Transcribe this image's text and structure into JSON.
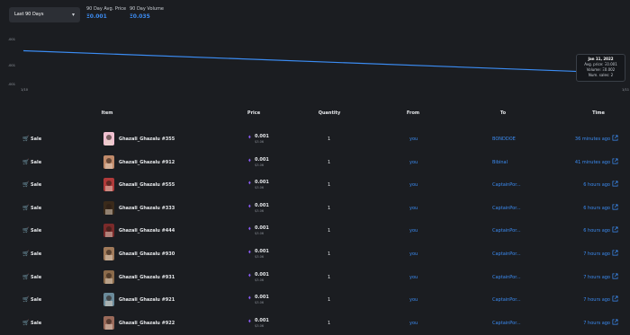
{
  "period": {
    "selected": "Last 90 Days"
  },
  "stats": {
    "avg_label": "90 Day Avg. Price",
    "avg_value": "Ξ0.001",
    "vol_label": "90 Day Volume",
    "vol_value": "Ξ0.035"
  },
  "chart_data": {
    "type": "line",
    "y_ticks": [
      ".001",
      ".001",
      ".001"
    ],
    "x_ticks": [
      "1/10",
      "1/11"
    ],
    "series": [
      {
        "points": [
          [
            0,
            0.0011
          ],
          [
            1,
            0.001
          ]
        ]
      }
    ],
    "line_color": "#3b8cf3",
    "tooltip": {
      "date": "Jan 11, 2022",
      "avg": "Avg. price: Ξ0.001",
      "volume": "Volume: Ξ0.002",
      "sales": "Num. sales: 2"
    }
  },
  "table": {
    "headers": [
      "Item",
      "Price",
      "Quantity",
      "From",
      "To",
      "Time"
    ],
    "rows": [
      {
        "event": "Sale",
        "item": "Ghazali_Ghazalu #355",
        "price": "0.001",
        "usd": "$3.06",
        "qty": "1",
        "from": "you",
        "to": "BONDDOE",
        "time": "36 minutes ago",
        "thumb": "#f0c0d0"
      },
      {
        "event": "Sale",
        "item": "Ghazali_Ghazalu #912",
        "price": "0.001",
        "usd": "$3.06",
        "qty": "1",
        "from": "you",
        "to": "Bibinal",
        "time": "41 minutes ago",
        "thumb": "#c08a6a"
      },
      {
        "event": "Sale",
        "item": "Ghazali_Ghazalu #555",
        "price": "0.001",
        "usd": "$3.06",
        "qty": "1",
        "from": "you",
        "to": "CaptainPor...",
        "time": "6 hours ago",
        "thumb": "#b03a3a"
      },
      {
        "event": "Sale",
        "item": "Ghazali_Ghazalu #333",
        "price": "0.001",
        "usd": "$3.06",
        "qty": "1",
        "from": "you",
        "to": "CaptainPor...",
        "time": "6 hours ago",
        "thumb": "#3a2a1a"
      },
      {
        "event": "Sale",
        "item": "Ghazali_Ghazalu #444",
        "price": "0.001",
        "usd": "$3.06",
        "qty": "1",
        "from": "you",
        "to": "CaptainPor...",
        "time": "6 hours ago",
        "thumb": "#7a2a2a"
      },
      {
        "event": "Sale",
        "item": "Ghazali_Ghazalu #930",
        "price": "0.001",
        "usd": "$3.06",
        "qty": "1",
        "from": "you",
        "to": "CaptainPor...",
        "time": "7 hours ago",
        "thumb": "#a07a5a"
      },
      {
        "event": "Sale",
        "item": "Ghazali_Ghazalu #931",
        "price": "0.001",
        "usd": "$3.06",
        "qty": "1",
        "from": "you",
        "to": "CaptainPor...",
        "time": "7 hours ago",
        "thumb": "#8a6a4a"
      },
      {
        "event": "Sale",
        "item": "Ghazali_Ghazalu #921",
        "price": "0.001",
        "usd": "$3.06",
        "qty": "1",
        "from": "you",
        "to": "CaptainPor...",
        "time": "7 hours ago",
        "thumb": "#6a8a9a"
      },
      {
        "event": "Sale",
        "item": "Ghazali_Ghazalu #922",
        "price": "0.001",
        "usd": "$3.06",
        "qty": "1",
        "from": "you",
        "to": "CaptainPor...",
        "time": "7 hours ago",
        "thumb": "#9a6a5a"
      }
    ]
  }
}
